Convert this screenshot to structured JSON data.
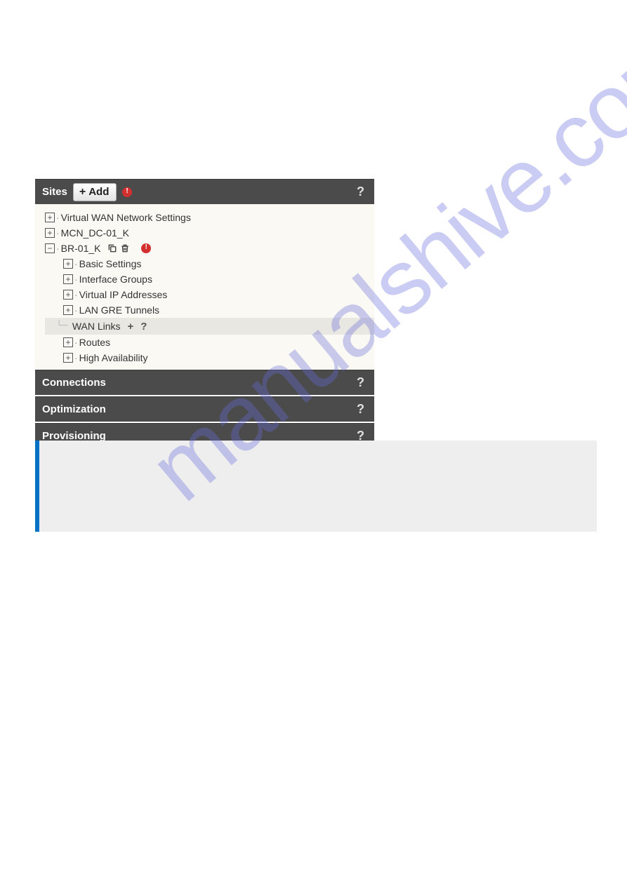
{
  "sites": {
    "title": "Sites",
    "add_label": "Add",
    "items": {
      "vwan": "Virtual WAN Network Settings",
      "mcn": "MCN_DC-01_K",
      "br": "BR-01_K",
      "br_children": {
        "basic": "Basic Settings",
        "igroups": "Interface Groups",
        "vip": "Virtual IP Addresses",
        "gre": "LAN GRE Tunnels",
        "wan": "WAN Links",
        "routes": "Routes",
        "ha": "High Availability"
      }
    }
  },
  "sections": {
    "connections": "Connections",
    "optimization": "Optimization",
    "provisioning": "Provisioning"
  },
  "help": "?",
  "plus": "+",
  "minus": "−",
  "watermark": "manualshive.com"
}
